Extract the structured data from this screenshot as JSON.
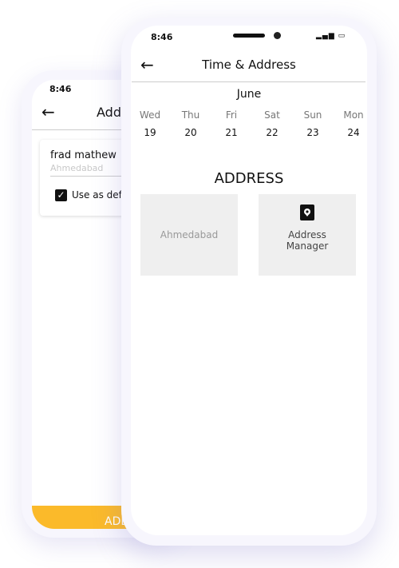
{
  "back_phone": {
    "status_time": "8:46",
    "header_title": "Addr",
    "address_card": {
      "name": "frad mathew",
      "city_placeholder": "Ahmedabad",
      "default_checkbox_label": "Use as defau",
      "default_checked": true
    },
    "bottom_button_label": "ADD",
    "accent_color": "#fbba2a"
  },
  "front_phone": {
    "status_time": "8:46",
    "header_title": "Time & Address",
    "month": "June",
    "days": [
      {
        "day": "Wed",
        "date": "19"
      },
      {
        "day": "Thu",
        "date": "20"
      },
      {
        "day": "Fri",
        "date": "21"
      },
      {
        "day": "Sat",
        "date": "22"
      },
      {
        "day": "Sun",
        "date": "23"
      },
      {
        "day": "Mon",
        "date": "24"
      }
    ],
    "address_heading": "ADDRESS",
    "address_options": [
      {
        "label": "Ahmedabad"
      },
      {
        "label": "Address Manager",
        "icon": "address-book-pin-icon"
      }
    ]
  }
}
